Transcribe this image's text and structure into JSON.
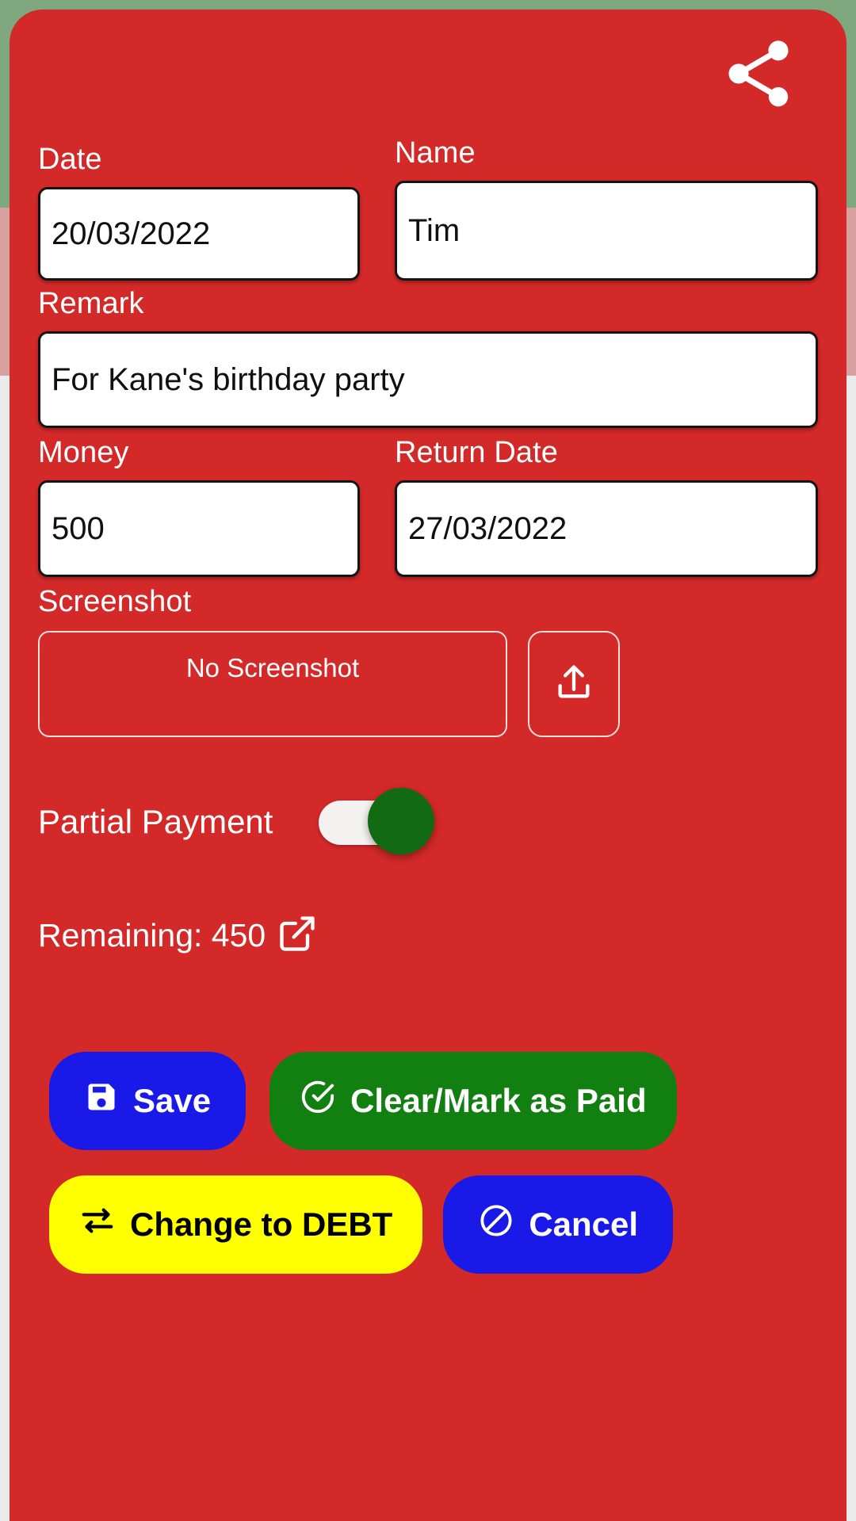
{
  "colors": {
    "dialog_bg": "#d32929",
    "save_btn": "#1a1ae8",
    "clear_btn": "#118011",
    "debt_btn": "#ffff00",
    "cancel_btn": "#1a1ae8",
    "toggle_thumb": "#126b12",
    "bg_top": "#7fa87f",
    "bg_mid": "#d9a0a0",
    "bg_bottom": "#eaeaea"
  },
  "header": {
    "share_icon": "share-icon"
  },
  "form": {
    "date": {
      "label": "Date",
      "value": "20/03/2022"
    },
    "name": {
      "label": "Name",
      "value": "Tim"
    },
    "remark": {
      "label": "Remark",
      "value": "For Kane's birthday party"
    },
    "money": {
      "label": "Money",
      "value": "500"
    },
    "return_date": {
      "label": "Return Date",
      "value": "27/03/2022"
    },
    "screenshot": {
      "label": "Screenshot",
      "empty_text": "No Screenshot",
      "upload_icon": "upload-icon"
    },
    "partial_payment": {
      "label": "Partial Payment",
      "state": "on"
    },
    "remaining": {
      "text": "Remaining: 450",
      "link_icon": "external-link-icon"
    }
  },
  "buttons": {
    "save": {
      "label": "Save",
      "icon": "save-floppy-icon"
    },
    "clear": {
      "label": "Clear/Mark as Paid",
      "icon": "check-circle-icon"
    },
    "change_to_debt": {
      "label": "Change to DEBT",
      "icon": "exchange-arrows-icon"
    },
    "cancel": {
      "label": "Cancel",
      "icon": "no-entry-icon"
    }
  }
}
